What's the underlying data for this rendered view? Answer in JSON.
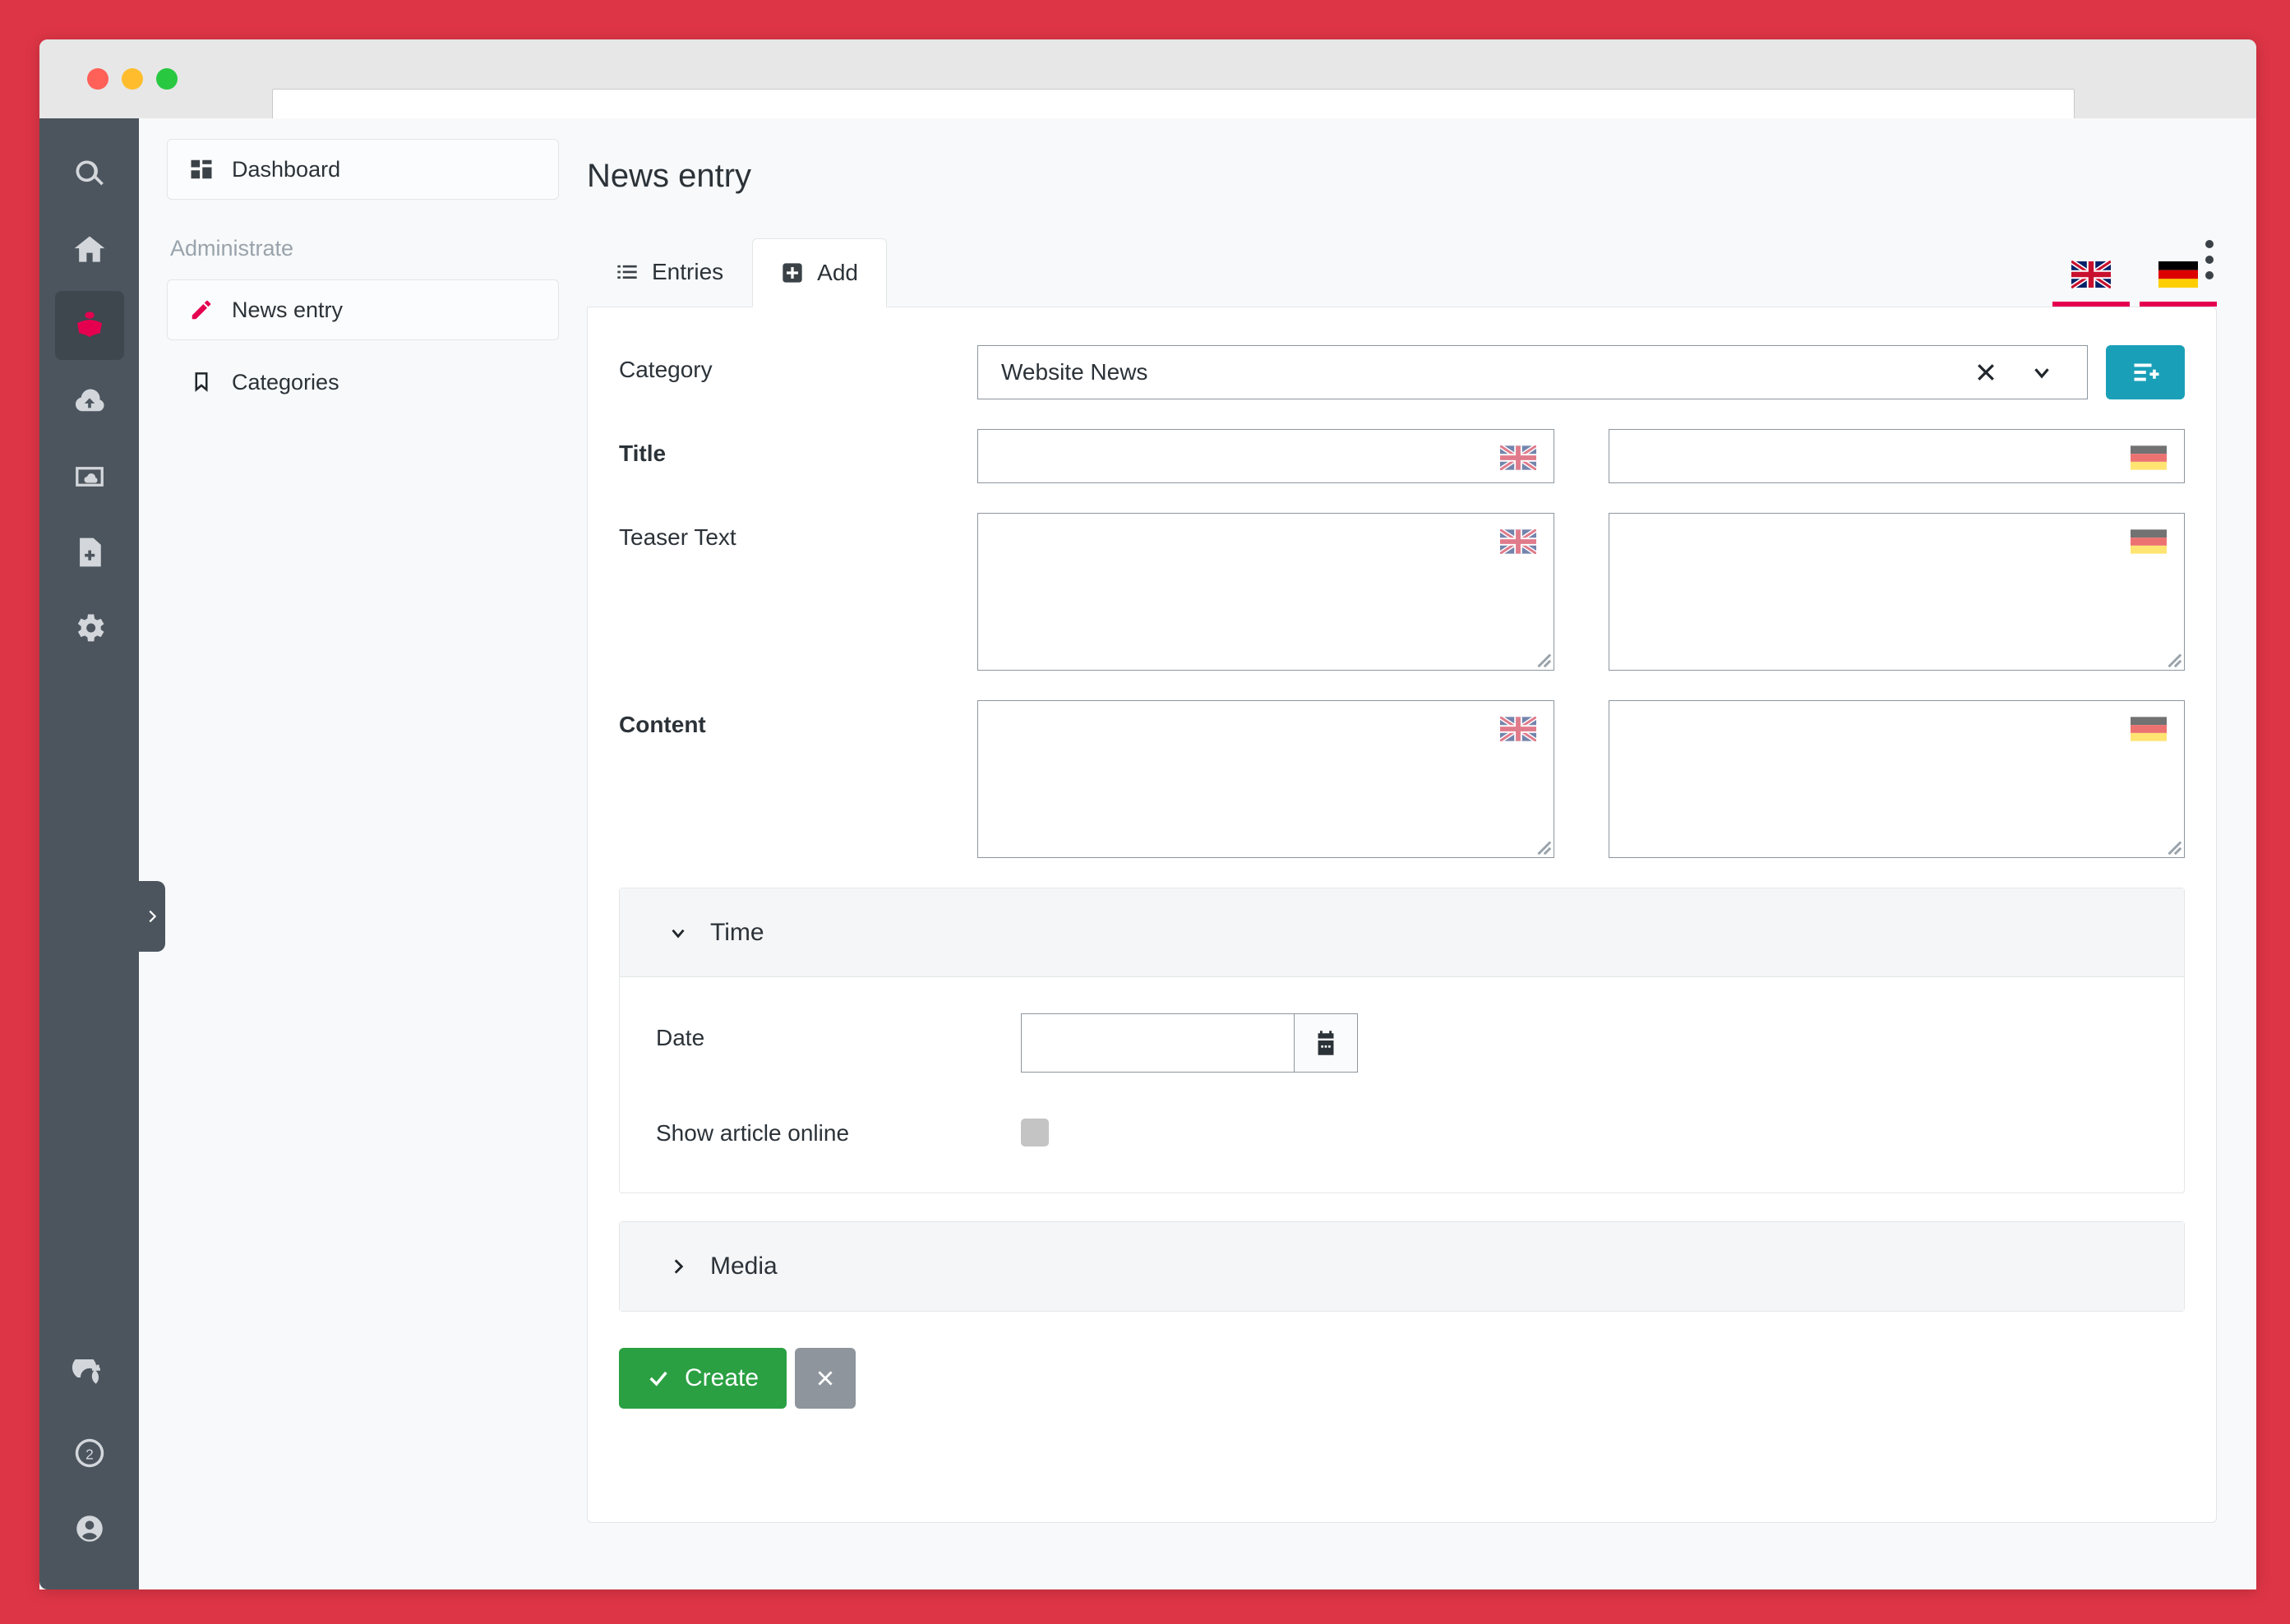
{
  "theme": {
    "page_background": "#de3546",
    "rail_background": "#4c555e",
    "accent_pink": "#e4004f",
    "teal_button": "#19a0b8",
    "create_green": "#2aa042",
    "cancel_grey": "#8e959c"
  },
  "browser": {
    "url_value": "",
    "url_placeholder": ""
  },
  "rail": {
    "top_items": [
      {
        "name": "search",
        "icon": "search-icon",
        "active": false
      },
      {
        "name": "home",
        "icon": "home-icon",
        "active": false
      },
      {
        "name": "news",
        "icon": "open-book-icon",
        "active": true
      },
      {
        "name": "upload",
        "icon": "cloud-upload-icon",
        "active": false
      },
      {
        "name": "media",
        "icon": "image-cloud-icon",
        "active": false
      },
      {
        "name": "new-document",
        "icon": "file-plus-icon",
        "active": false
      },
      {
        "name": "settings",
        "icon": "gear-icon",
        "active": false
      }
    ],
    "bottom_items": [
      {
        "name": "refresh",
        "icon": "refresh-icon"
      },
      {
        "name": "notifications",
        "icon": "circle-two-icon",
        "badge": "2"
      },
      {
        "name": "account",
        "icon": "user-icon"
      }
    ],
    "collapse_handle": "chevron-right-icon"
  },
  "sidebar": {
    "dashboard": {
      "label": "Dashboard",
      "icon": "dashboard-grid-icon"
    },
    "section_label": "Administrate",
    "items": [
      {
        "label": "News entry",
        "icon": "pencil-icon",
        "selected": true
      },
      {
        "label": "Categories",
        "icon": "bookmark-icon",
        "selected": false
      }
    ]
  },
  "header": {
    "title": "News entry",
    "menu_icon": "kebab-menu-icon"
  },
  "tabs": [
    {
      "label": "Entries",
      "icon": "list-icon",
      "active": false
    },
    {
      "label": "Add",
      "icon": "plus-square-icon",
      "active": true
    }
  ],
  "language_tabs": [
    {
      "name": "english",
      "icon": "uk-flag-icon",
      "active": true
    },
    {
      "name": "german",
      "icon": "german-flag-icon",
      "active": true
    }
  ],
  "form": {
    "category": {
      "label": "Category",
      "value": "Website News",
      "clear_icon": "close-x-icon",
      "caret_icon": "chevron-down-icon",
      "add_button_icon": "add-list-item-icon"
    },
    "fields": [
      {
        "label": "Title",
        "bold": true,
        "type": "input",
        "en": {
          "value": "",
          "placeholder": "",
          "flag": "uk-flag-icon"
        },
        "de": {
          "value": "",
          "placeholder": "",
          "flag": "german-flag-icon"
        }
      },
      {
        "label": "Teaser Text",
        "bold": false,
        "type": "textarea",
        "en": {
          "value": "",
          "placeholder": "",
          "flag": "uk-flag-icon"
        },
        "de": {
          "value": "",
          "placeholder": "",
          "flag": "german-flag-icon"
        }
      },
      {
        "label": "Content",
        "bold": true,
        "type": "textarea",
        "en": {
          "value": "",
          "placeholder": "",
          "flag": "uk-flag-icon"
        },
        "de": {
          "value": "",
          "placeholder": "",
          "flag": "german-flag-icon"
        }
      }
    ],
    "time_panel": {
      "title": "Time",
      "expanded": true,
      "chevron": "chevron-down-icon",
      "date": {
        "label": "Date",
        "value": "",
        "placeholder": "",
        "button_icon": "calendar-icon"
      },
      "show_online": {
        "label": "Show article online",
        "checked": false
      }
    },
    "media_panel": {
      "title": "Media",
      "expanded": false,
      "chevron": "chevron-right-icon"
    }
  },
  "actions": {
    "create_label": "Create",
    "create_icon": "check-icon",
    "cancel_icon": "close-x-icon"
  }
}
